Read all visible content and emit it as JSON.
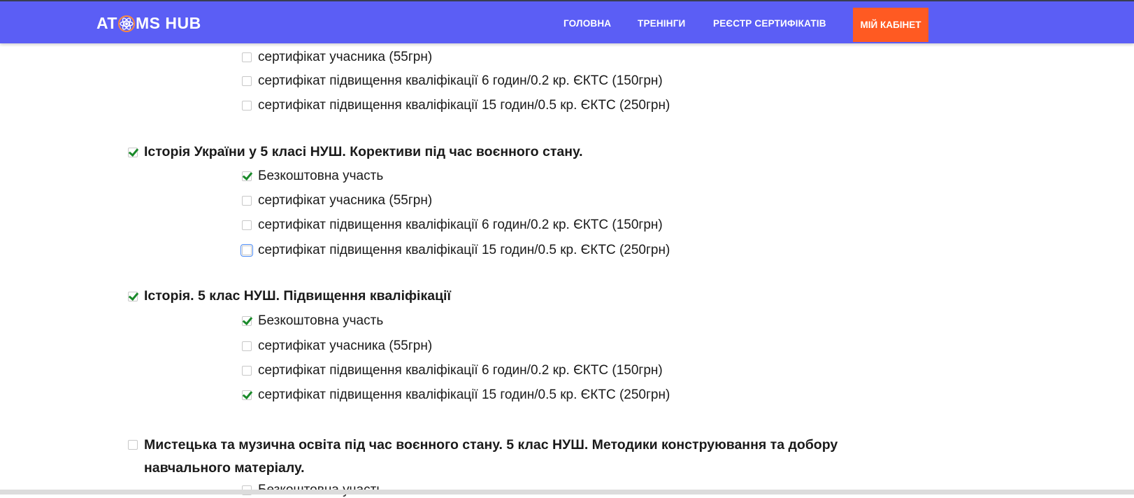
{
  "nav": {
    "logo": "ATOMS HUB",
    "logo_left": "AT",
    "logo_right": "MS HUB",
    "links": [
      "ГОЛОВНА",
      "ТРЕНІНГИ",
      "РЕЄСТР СЕРТИФІКАТІВ"
    ],
    "cta": "МІЙ КАБІНЕТ"
  },
  "colors": {
    "navbar": "#5b5ef5",
    "cta": "#ff5a22",
    "check": "#1a8a2a"
  },
  "partial_group": {
    "options": [
      {
        "label": "сертифікат учасника (55грн)",
        "checked": false
      },
      {
        "label": "сертифікат підвищення кваліфікації 6 годин/0.2 кр. ЄКТС (150грн)",
        "checked": false
      },
      {
        "label": "сертифікат підвищення кваліфікації 15 годин/0.5 кр. ЄКТС (250грн)",
        "checked": false
      }
    ]
  },
  "courses": [
    {
      "title": "Історія України у 5 класі НУШ. Корективи під час воєнного стану.",
      "checked": true,
      "options": [
        {
          "label": "Безкоштовна участь",
          "checked": true
        },
        {
          "label": "сертифікат учасника (55грн)",
          "checked": false
        },
        {
          "label": "сертифікат підвищення кваліфікації 6 годин/0.2 кр. ЄКТС (150грн)",
          "checked": false
        },
        {
          "label": "сертифікат підвищення кваліфікації 15 годин/0.5 кр. ЄКТС (250грн)",
          "checked": false
        }
      ]
    },
    {
      "title": "Історія. 5 клас НУШ. Підвищення кваліфікації",
      "checked": true,
      "options": [
        {
          "label": "Безкоштовна участь",
          "checked": true
        },
        {
          "label": "сертифікат учасника (55грн)",
          "checked": false
        },
        {
          "label": "сертифікат підвищення кваліфікації 6 годин/0.2 кр. ЄКТС (150грн)",
          "checked": false
        },
        {
          "label": "сертифікат підвищення кваліфікації 15 годин/0.5 кр. ЄКТС (250грн)",
          "checked": true
        }
      ]
    },
    {
      "title": "Мистецька та музична освіта під час воєнного стану. 5 клас НУШ. Методики конструювання та добору навчального матеріалу.",
      "checked": false,
      "options": [
        {
          "label": "Безкоштовна участь",
          "checked": false
        }
      ]
    }
  ]
}
